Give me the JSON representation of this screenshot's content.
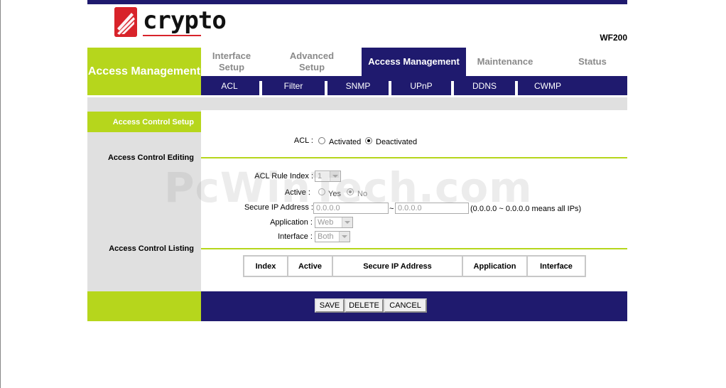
{
  "brand": {
    "logo_text": "crypto",
    "model": "WF200"
  },
  "section": {
    "title": "Access Management"
  },
  "tabs": [
    {
      "label": "Interface Setup"
    },
    {
      "label": "Advanced Setup"
    },
    {
      "label": "Access Management",
      "active": true
    },
    {
      "label": "Maintenance"
    },
    {
      "label": "Status"
    }
  ],
  "subtabs": [
    {
      "label": "ACL"
    },
    {
      "label": "Filter"
    },
    {
      "label": "SNMP"
    },
    {
      "label": "UPnP"
    },
    {
      "label": "DDNS"
    },
    {
      "label": "CWMP"
    }
  ],
  "sidebar": {
    "header": "Access Control Setup",
    "editing": "Access Control Editing",
    "listing": "Access Control Listing"
  },
  "form": {
    "acl": {
      "label": "ACL :",
      "opt_activated": "Activated",
      "opt_deactivated": "Deactivated",
      "selected": "Deactivated"
    },
    "rule_index": {
      "label": "ACL Rule Index :",
      "value": "1"
    },
    "active": {
      "label": "Active :",
      "opt_yes": "Yes",
      "opt_no": "No",
      "selected": "No"
    },
    "secure_ip": {
      "label": "Secure IP Address :",
      "start": "0.0.0.0",
      "sep": "~",
      "end": "0.0.0.0",
      "hint": "(0.0.0.0 ~ 0.0.0.0 means all IPs)"
    },
    "application": {
      "label": "Application :",
      "value": "Web"
    },
    "interface": {
      "label": "Interface :",
      "value": "Both"
    }
  },
  "table": {
    "headers": [
      "Index",
      "Active",
      "Secure IP Address",
      "Application",
      "Interface"
    ]
  },
  "buttons": {
    "save": "SAVE",
    "delete": "DELETE",
    "cancel": "CANCEL"
  },
  "watermark": "PcWinTech.com",
  "colors": {
    "navy": "#1f1a6e",
    "green": "#b6d61c",
    "grey": "#e0e0e0",
    "logo_red": "#d8232a"
  }
}
